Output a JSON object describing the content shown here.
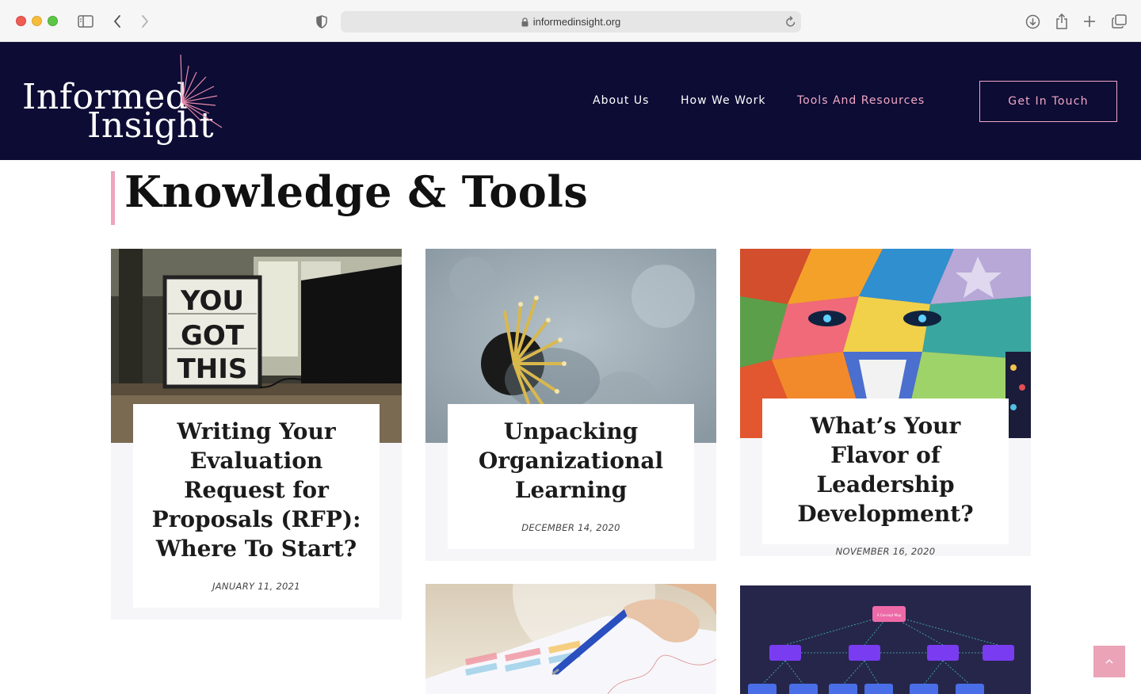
{
  "browser": {
    "url": "informedinsight.org"
  },
  "site": {
    "logo_line1": "Informed",
    "logo_line2": "Insight",
    "nav": [
      {
        "label": "About Us"
      },
      {
        "label": "How We Work"
      },
      {
        "label": "Tools And Resources"
      }
    ],
    "cta_label": "Get In Touch",
    "accent_color": "#f3a8c4",
    "header_color": "#0c0c35"
  },
  "page": {
    "title": "Knowledge & Tools"
  },
  "posts": [
    {
      "title": "Writing Your Evaluation Request for Proposals (RFP): Where To Start?",
      "date": "JANUARY 11, 2021",
      "image": "lightbox-you-got-this",
      "lightbox_lines": [
        "YOU",
        "GOT",
        "THIS"
      ]
    },
    {
      "title": "Unpacking Organizational Learning",
      "date": "DECEMBER 14, 2020",
      "image": "pencils-in-cup"
    },
    {
      "title": "What’s Your Flavor of Leadership Development?",
      "date": "NOVEMBER 16, 2020",
      "image": "geometric-lion-mural"
    },
    {
      "image": "hand-with-pen-on-chart"
    },
    {
      "image": "concept-map-diagram",
      "diagram_labels": [
        "A Concept Map"
      ]
    }
  ]
}
